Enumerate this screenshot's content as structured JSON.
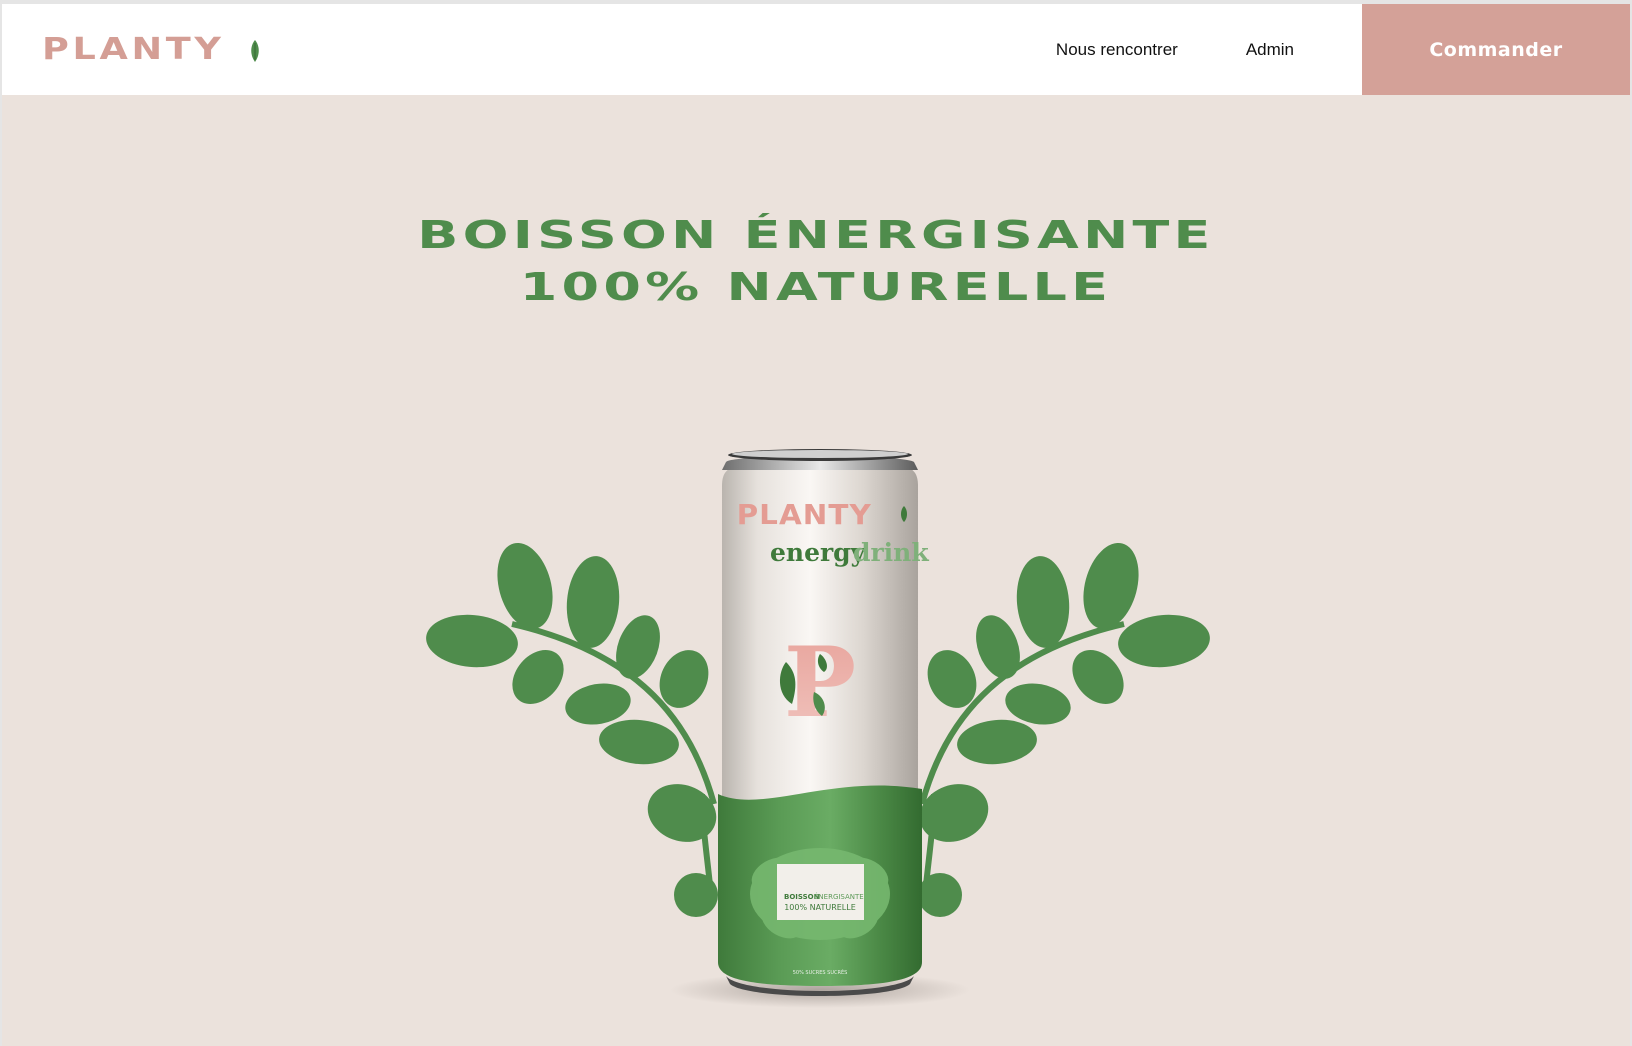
{
  "brand": {
    "name": "PLANTY",
    "accent": "#d4a198",
    "green": "#4f8c4c",
    "background": "#ebe2dc"
  },
  "nav": {
    "links": [
      "Nous rencontrer",
      "Admin"
    ],
    "cta": "Commander"
  },
  "hero": {
    "title_line1": "BOISSON ÉNERGISANTE",
    "title_line2": "100% NATURELLE"
  },
  "product": {
    "brand": "PLANTY",
    "subtitle_word1": "energy",
    "subtitle_word2": "drink",
    "monogram": "P",
    "label_line1_word1": "BOISSON",
    "label_line1_word2": "ÉNERGISANTE",
    "label_line2": "100% NATURELLE",
    "fine_print": "50% SUCRES SUCRÉS"
  }
}
